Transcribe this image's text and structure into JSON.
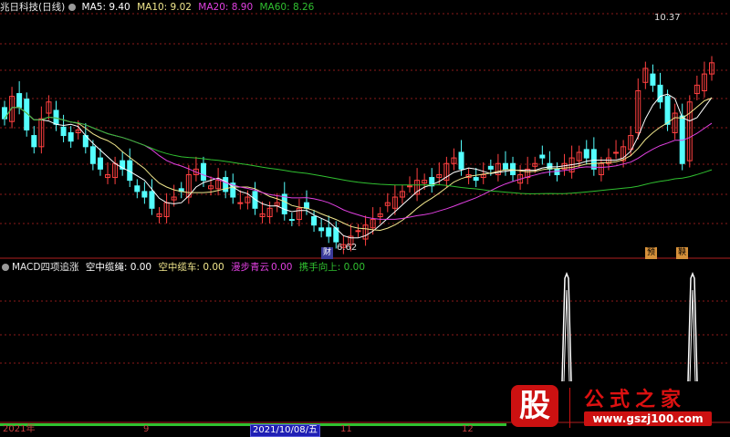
{
  "main_panel": {
    "title": "兆日科技(日线)",
    "ma": [
      {
        "label": "MA5: 9.40",
        "color": "#ffffff"
      },
      {
        "label": "MA10: 9.02",
        "color": "#f0e68c"
      },
      {
        "label": "MA20: 8.90",
        "color": "#e040e0"
      },
      {
        "label": "MA60: 8.26",
        "color": "#30c030"
      }
    ],
    "high_label": "10.37",
    "low_label": "6.62",
    "badges": [
      "财",
      "预",
      "鞅"
    ]
  },
  "sub_panel": {
    "title": "MACD四项追涨",
    "items": [
      {
        "label": "空中缆绳: 0.00",
        "color": "#ffffff"
      },
      {
        "label": "空中缆车: 0.00",
        "color": "#f0e68c"
      },
      {
        "label": "漫步青云",
        "color": "#e040e0"
      },
      {
        "label": "0.00",
        "color": "#e040e0"
      },
      {
        "label": "携手向上: 0.00",
        "color": "#30c030"
      }
    ]
  },
  "x_axis": {
    "labels": [
      "2021年",
      "9",
      "11",
      "12"
    ],
    "cursor_date": "2021/10/08/五"
  },
  "watermark": {
    "logo_char": "股",
    "title": "公式之家",
    "url": "www.gszj100.com"
  },
  "colors": {
    "up": "#ff4040",
    "down": "#54ffff",
    "grid": "#8b1a1a"
  }
}
